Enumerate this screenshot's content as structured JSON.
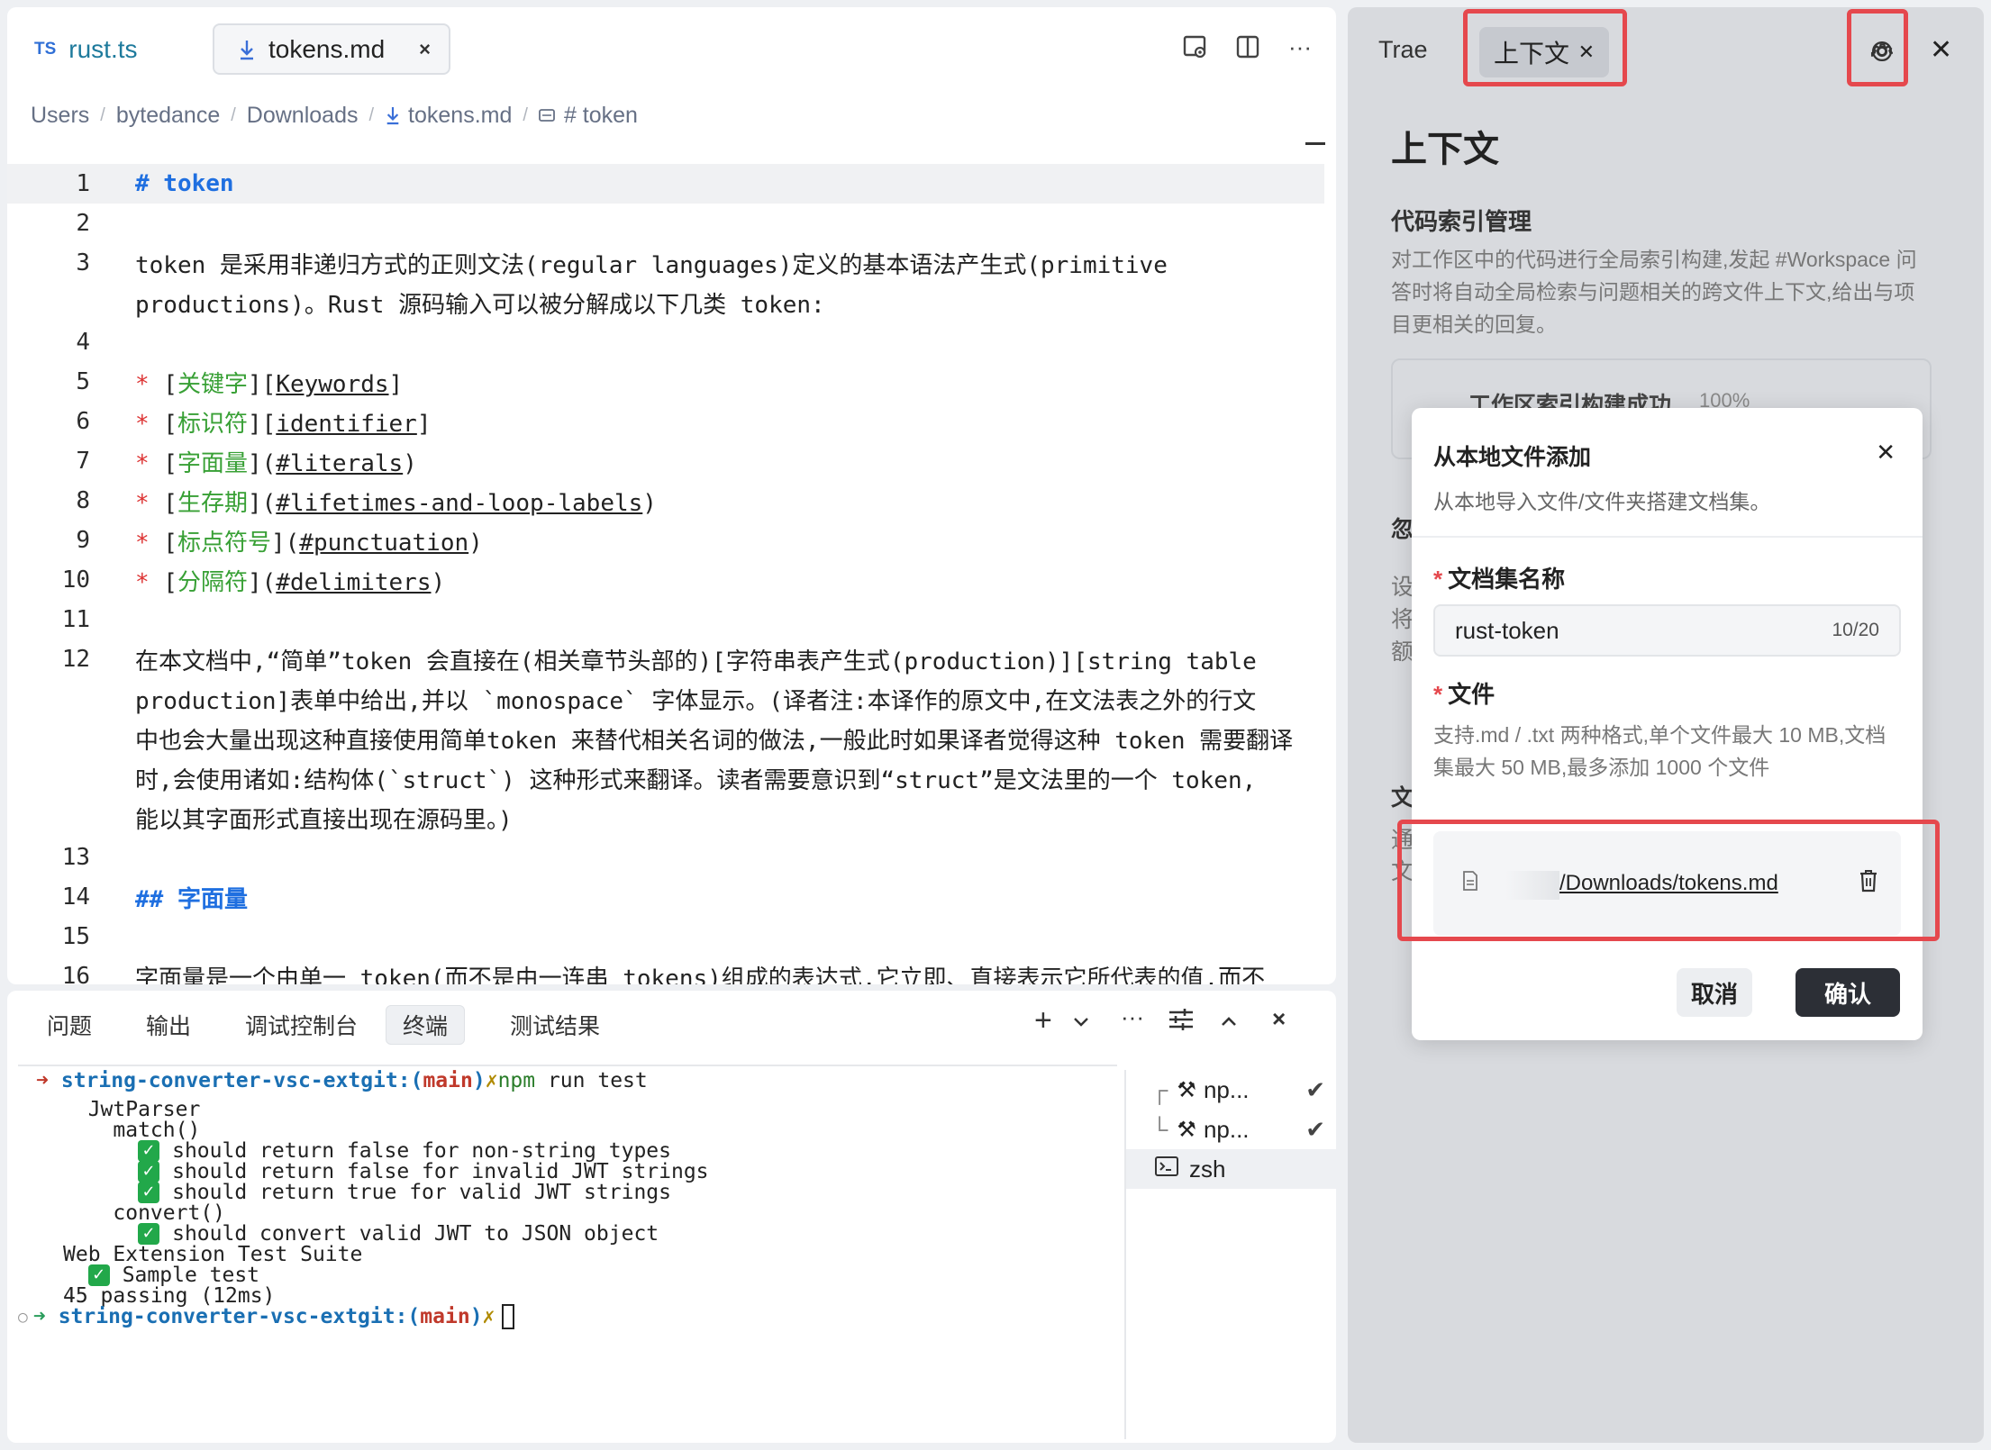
{
  "editor": {
    "tabs": [
      {
        "badge": "TS",
        "label": "rust.ts"
      },
      {
        "label": "tokens.md",
        "close": "×"
      }
    ],
    "toolbar": {
      "more": "···"
    },
    "breadcrumb": [
      "Users",
      "bytedance",
      "Downloads",
      "tokens.md",
      "# token"
    ],
    "lines": [
      {
        "n": "1",
        "t": "# token"
      },
      {
        "n": "2",
        "t": ""
      },
      {
        "n": "3",
        "t": "token 是采用非递归方式的正则文法(regular languages)定义的基本语法产生式(primitive"
      },
      {
        "n": "",
        "t": "productions)。Rust 源码输入可以被分解成以下几类 token:"
      },
      {
        "n": "4",
        "t": ""
      },
      {
        "n": "5",
        "pre": "* [",
        "link": "关键字",
        "post": "][Keywords]"
      },
      {
        "n": "6",
        "pre": "* [",
        "link": "标识符",
        "post": "][identifier]"
      },
      {
        "n": "7",
        "pre": "* [",
        "link": "字面量",
        "post": "](#literals)"
      },
      {
        "n": "8",
        "pre": "* [",
        "link": "生存期",
        "post": "](#lifetimes-and-loop-labels)"
      },
      {
        "n": "9",
        "pre": "* [",
        "link": "标点符号",
        "post": "](#punctuation)"
      },
      {
        "n": "10",
        "pre": "* [",
        "link": "分隔符",
        "post": "](#delimiters)"
      },
      {
        "n": "11",
        "t": ""
      },
      {
        "n": "12",
        "t": "在本文档中,“简单”token 会直接在(相关章节头部的)[字符串表产生式(production)][string table"
      },
      {
        "n": "",
        "t": "production]表单中给出,并以 `monospace` 字体显示。(译者注:本译作的原文中,在文法表之外的行文"
      },
      {
        "n": "",
        "t": "中也会大量出现这种直接使用简单token 来替代相关名词的做法,一般此时如果译者觉得这种 token 需要翻译"
      },
      {
        "n": "",
        "t": "时,会使用诸如:结构体(`struct`) 这种形式来翻译。读者需要意识到“struct”是文法里的一个 token,"
      },
      {
        "n": "",
        "t": "能以其字面形式直接出现在源码里。)"
      },
      {
        "n": "13",
        "t": ""
      },
      {
        "n": "14",
        "t": "## 字面量"
      },
      {
        "n": "15",
        "t": ""
      },
      {
        "n": "16",
        "t": "字面量是一个由单一 token(而不是由一连串 tokens)组成的表达式,它立即、直接表示它所代表的值,而不"
      }
    ]
  },
  "panel": {
    "tabs": [
      "问题",
      "输出",
      "调试控制台",
      "终端",
      "测试结果"
    ],
    "active_tab": "终端",
    "terminal": {
      "prompt_arrow": "➜",
      "dir": "string-converter-vsc-ext",
      "git": "git:(",
      "branch": "main",
      "git_close": ")",
      "x": "✗",
      "cmd_npm": "npm",
      "cmd_rest": " run test",
      "lines": [
        {
          "indent": "  ",
          "text": "JwtParser"
        },
        {
          "indent": "    ",
          "text": "match()"
        },
        {
          "indent": "      ",
          "check": true,
          "text": "should return false for non-string types"
        },
        {
          "indent": "      ",
          "check": true,
          "text": "should return false for invalid JWT strings"
        },
        {
          "indent": "      ",
          "check": true,
          "text": "should return true for valid JWT strings"
        },
        {
          "indent": "    ",
          "text": "convert()"
        },
        {
          "indent": "      ",
          "check": true,
          "text": "should convert valid JWT to JSON object"
        },
        {
          "indent": "",
          "text": "Web Extension Test Suite"
        },
        {
          "indent": "  ",
          "check": true,
          "text": "Sample test"
        },
        {
          "indent": "",
          "text": "45 passing (12ms)"
        }
      ]
    },
    "terminal_list": [
      {
        "label": "np...",
        "tree": "┌",
        "done": "✔"
      },
      {
        "label": "np...",
        "tree": "└",
        "done": "✔"
      },
      {
        "label": "zsh"
      }
    ]
  },
  "sidebar": {
    "tabs": [
      "Trae",
      "上下文"
    ],
    "title": "上下文",
    "index_heading": "代码索引管理",
    "index_desc": "对工作区中的代码进行全局索引构建,发起 #Workspace 问答时将自动全局检索与问题相关的跨文件上下文,给出与项目更相关的回复。",
    "index_status": "工作区索引构建成功",
    "index_percent": "100%",
    "partial": [
      "忽",
      "设",
      "将",
      "额",
      "文",
      "通",
      "文"
    ]
  },
  "modal": {
    "title": "从本地文件添加",
    "subtitle": "从本地导入文件/文件夹搭建文档集。",
    "name_label": "文档集名称",
    "name_value": "rust-token",
    "name_count": "10/20",
    "files_label": "文件",
    "files_hint": "支持.md / .txt 两种格式,单个文件最大 10 MB,文档集最大 50 MB,最多添加 1000 个文件",
    "file_path": "/Downloads/tokens.md",
    "cancel": "取消",
    "confirm": "确认"
  }
}
